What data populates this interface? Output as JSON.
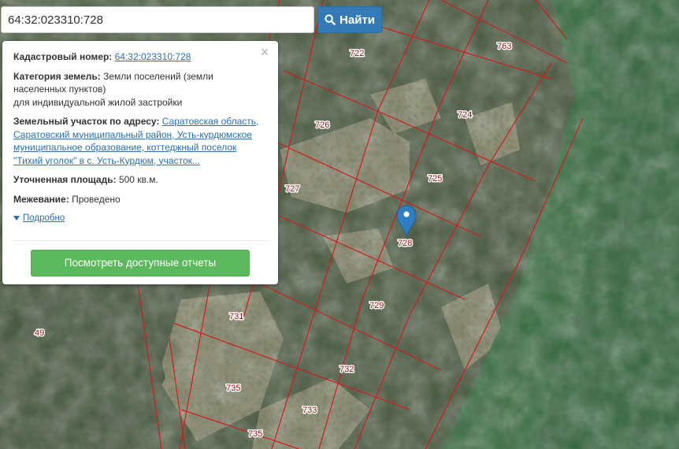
{
  "search": {
    "value": "64:32:023310:728",
    "button_label": "Найти"
  },
  "popup": {
    "cadastral_label": "Кадастровый номер:",
    "cadastral_value": "64:32:023310:728",
    "category_label": "Категория земель:",
    "category_value": "Земли поселений (земли населенных пунктов)",
    "category_use": "для индивидуальной жилой застройки",
    "address_label": "Земельный участок по адресу:",
    "address_value": "Саратовская область, Саратовский муниципальный район, Усть-курдюмское муниципальное образование, коттеджный поселок \"Тихий уголок\" в с. Усть-Курдюм, участок...",
    "area_label": "Уточненная площадь:",
    "area_value": "500 кв.м.",
    "survey_label": "Межевание:",
    "survey_value": "Проведено",
    "more_link": "Подробно",
    "reports_button": "Посмотреть доступные отчеты",
    "close_glyph": "×"
  },
  "map": {
    "selected_plot": "728",
    "plot_numbers": [
      "722",
      "763",
      "724",
      "726",
      "725",
      "727",
      "728",
      "729",
      "731",
      "49",
      "732",
      "735",
      "733",
      "735"
    ]
  },
  "colors": {
    "boundary": "#d21c1c",
    "marker": "#2f7ec4",
    "search_button": "#337ab7",
    "reports_button": "#5cb85c",
    "link": "#2a6fb0"
  },
  "icons": {
    "search_button": "magnifier-icon",
    "marker": "map-pin-icon",
    "close": "close-icon",
    "more": "triangle-down-icon"
  }
}
